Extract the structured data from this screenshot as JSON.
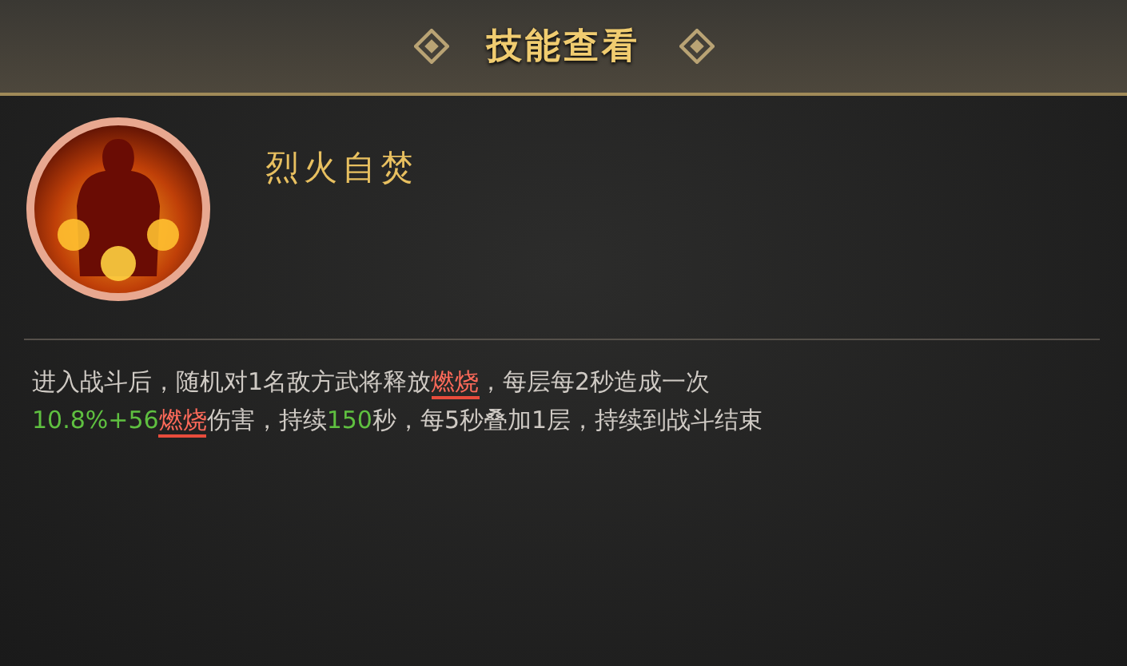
{
  "header": {
    "title": "技能查看"
  },
  "skill": {
    "name": "烈火自焚",
    "description": [
      [
        {
          "kind": "text",
          "text": "进入战斗后，随机对1名敌方武将释放"
        },
        {
          "kind": "keyword",
          "text": "燃烧"
        },
        {
          "kind": "text",
          "text": "，每层每2秒造成一次"
        }
      ],
      [
        {
          "kind": "value",
          "text": "10.8%+56"
        },
        {
          "kind": "keyword",
          "text": "燃烧"
        },
        {
          "kind": "text",
          "text": "伤害，持续"
        },
        {
          "kind": "value",
          "text": "150"
        },
        {
          "kind": "text",
          "text": "秒，每5秒叠加1层，持续到战斗结束"
        }
      ]
    ]
  }
}
